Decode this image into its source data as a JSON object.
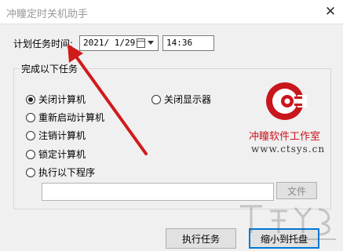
{
  "window": {
    "title": "冲瞳定时关机助手",
    "close_glyph": "✕"
  },
  "task_time": {
    "label": "计划任务时间:",
    "date_value": "2021/ 1/29",
    "time_value": "14:36"
  },
  "group": {
    "title": "完成以下任务",
    "options": [
      {
        "label": "关闭计算机",
        "checked": true
      },
      {
        "label": "重新启动计算机",
        "checked": false
      },
      {
        "label": "注销计算机",
        "checked": false
      },
      {
        "label": "锁定计算机",
        "checked": false
      },
      {
        "label": "执行以下程序",
        "checked": false
      },
      {
        "label": "关闭显示器",
        "checked": false
      }
    ],
    "program_path": "",
    "file_button": "文件"
  },
  "branding": {
    "name": "冲瞳软件工作室",
    "url": "www.ctsys.cn",
    "accent": "#c8161d"
  },
  "buttons": {
    "execute": "执行任务",
    "minimize_tray": "缩小到托盘"
  },
  "annotation": {
    "arrow_color": "#d11a1a"
  }
}
